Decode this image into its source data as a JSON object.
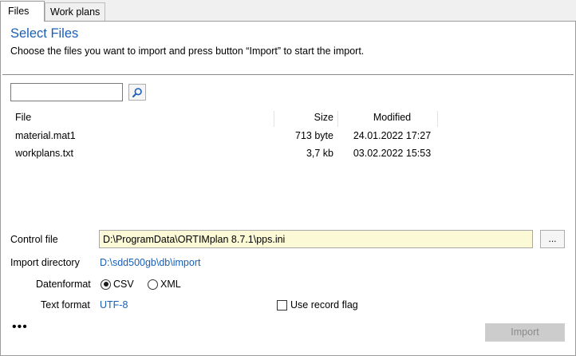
{
  "tabs": [
    {
      "label": "Files",
      "active": true
    },
    {
      "label": "Work plans",
      "active": false
    }
  ],
  "header": {
    "title": "Select Files",
    "subtitle": "Choose the files you want to import and press button “Import” to start the import."
  },
  "search": {
    "value": "",
    "placeholder": "",
    "button_icon": "search-icon"
  },
  "table": {
    "columns": [
      "File",
      "Size",
      "Modified"
    ],
    "rows": [
      {
        "file": "material.mat1",
        "size": "713 byte",
        "modified": "24.01.2022 17:27"
      },
      {
        "file": "workplans.txt",
        "size": "3,7 kb",
        "modified": "03.02.2022 15:53"
      }
    ]
  },
  "control_file": {
    "label": "Control file",
    "value": "D:\\ProgramData\\ORTIMplan 8.7.1\\pps.ini",
    "browse_label": "..."
  },
  "import_directory": {
    "label": "Import directory",
    "value": "D:\\sdd500gb\\db\\import"
  },
  "data_format": {
    "label": "Datenformat",
    "options": [
      "CSV",
      "XML"
    ],
    "selected": "CSV"
  },
  "text_format": {
    "label": "Text format",
    "value": "UTF-8"
  },
  "record_flag": {
    "label": "Use record flag",
    "checked": false
  },
  "footer": {
    "more_label": "•••",
    "import_label": "Import",
    "import_enabled": false
  },
  "colors": {
    "accent": "#1a5fb4",
    "control_file_bg": "#fbf9d6",
    "disabled_button": "#cccccc"
  }
}
